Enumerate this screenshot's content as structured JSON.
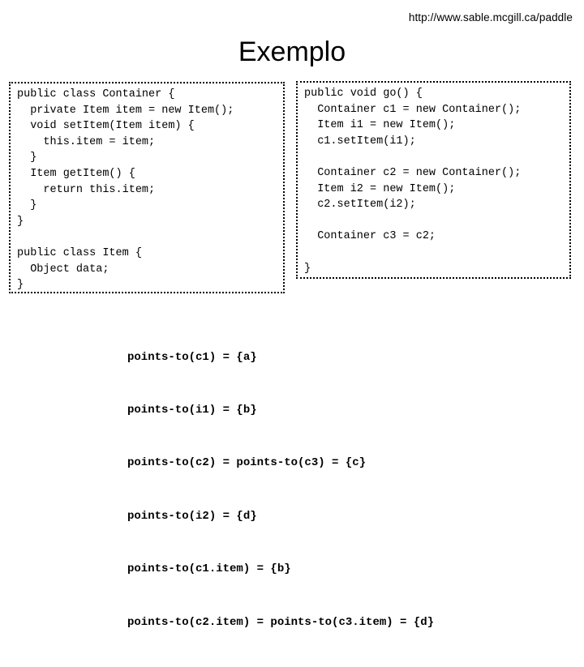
{
  "header": {
    "url": "http://www.sable.mcgill.ca/paddle"
  },
  "title": "Exemplo",
  "code_left": {
    "lines": [
      "public class Container {",
      "  private Item item = new Item();",
      "  void setItem(Item item) {",
      "    this.item = item;",
      "  }",
      "  Item getItem() {",
      "    return this.item;",
      "  }",
      "}",
      "",
      "public class Item {",
      "  Object data;",
      "}"
    ],
    "text": "public class Container {\n  private Item item = new Item();\n  void setItem(Item item) {\n    this.item = item;\n  }\n  Item getItem() {\n    return this.item;\n  }\n}\n\npublic class Item {\n  Object data;\n}"
  },
  "code_right": {
    "lines": [
      "public void go() {",
      "  Container c1 = new Container();",
      "  Item i1 = new Item();",
      "  c1.setItem(i1);",
      "",
      "  Container c2 = new Container();",
      "  Item i2 = new Item();",
      "  c2.setItem(i2);",
      "",
      "  Container c3 = c2;",
      "",
      "}"
    ],
    "text": "public void go() {\n  Container c1 = new Container();\n  Item i1 = new Item();\n  c1.setItem(i1);\n\n  Container c2 = new Container();\n  Item i2 = new Item();\n  c2.setItem(i2);\n\n  Container c3 = c2;\n\n}"
  },
  "points_to": {
    "lines": [
      "points-to(c1) = {a}",
      "points-to(i1) = {b}",
      "points-to(c2) = points-to(c3) = {c}",
      "points-to(i2) = {d}",
      "points-to(c1.item) = {b}",
      "points-to(c2.item) = points-to(c3.item) = {d}"
    ]
  },
  "colors": {
    "text": "#000000",
    "background": "#ffffff",
    "border": "#000000"
  }
}
